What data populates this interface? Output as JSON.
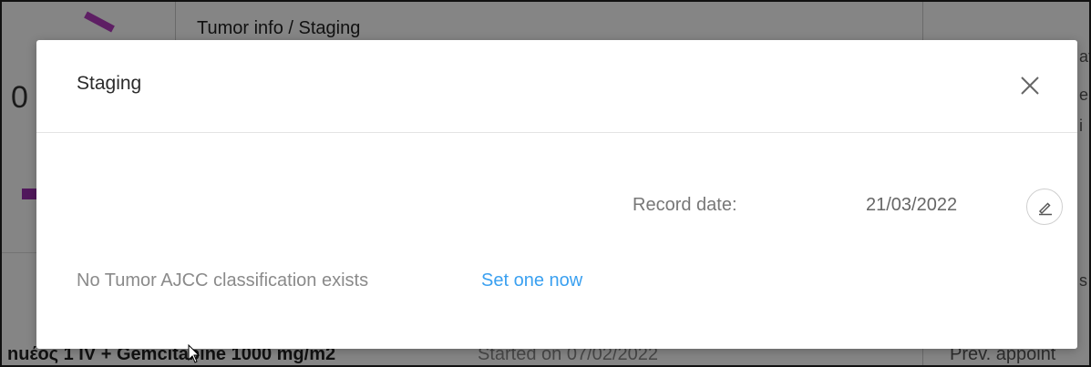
{
  "background": {
    "section_title": "Tumor info / Staging",
    "row_text": "nuέος 1  IV + Gemcitabine 1000 mg/m2",
    "row_status": "Started on 07/02/2022",
    "right_fragment": "Prev. appoint",
    "left_fragment": "0",
    "right_fragments": [
      "at",
      "e",
      "i",
      "s"
    ]
  },
  "modal": {
    "title": "Staging",
    "close_icon": "close-icon",
    "record_date_label": "Record date:",
    "record_date_value": "21/03/2022",
    "edit_icon": "pencil-icon",
    "empty_message": "No Tumor AJCC classification exists",
    "set_link": "Set one now"
  },
  "colors": {
    "overlay": "#000000",
    "link": "#3aa0f0",
    "accent_stripe": "#b43cc0"
  }
}
